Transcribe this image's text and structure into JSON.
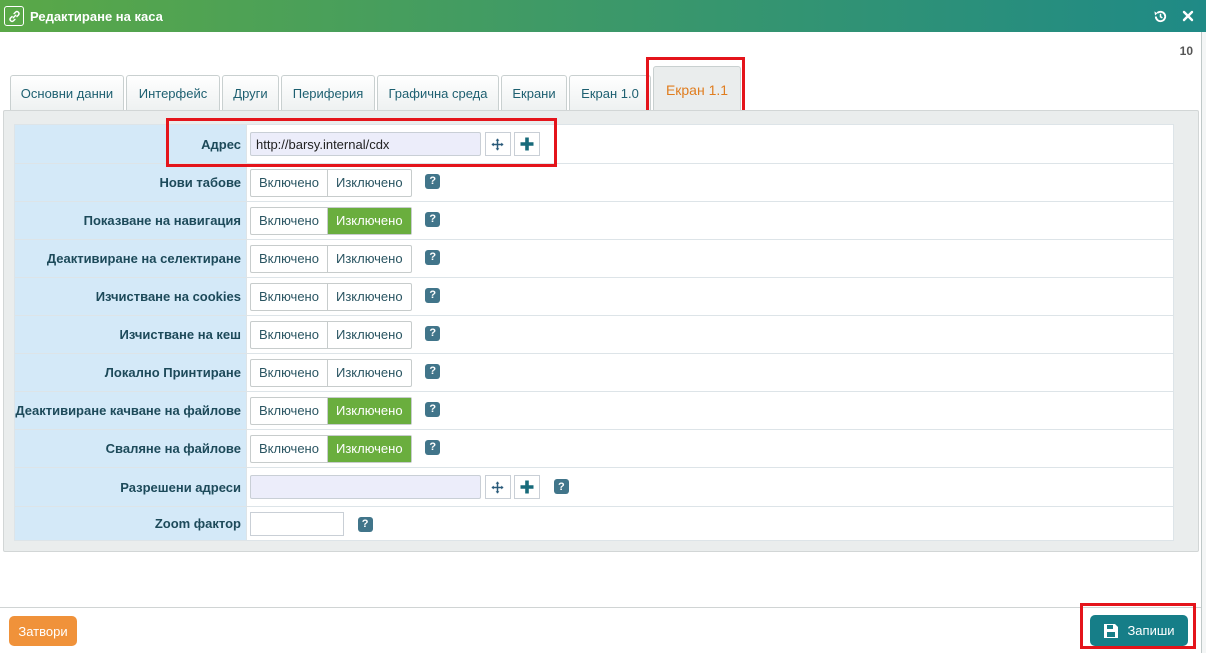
{
  "window": {
    "title": "Редактиране на каса",
    "link_icon": "link-icon",
    "history_icon": "history-icon",
    "close_icon": "close-icon",
    "record_number": "10"
  },
  "tabs": [
    {
      "label": "Основни данни"
    },
    {
      "label": "Интерфейс"
    },
    {
      "label": "Други"
    },
    {
      "label": "Периферия"
    },
    {
      "label": "Графична среда"
    },
    {
      "label": "Екрани"
    },
    {
      "label": "Екран 1.0"
    },
    {
      "label": "Екран 1.1",
      "active": true
    }
  ],
  "form": {
    "address": {
      "label": "Адрес",
      "value": "http://barsy.internal/cdx"
    },
    "toggle_on": "Включено",
    "toggle_off": "Изключено",
    "help_glyph": "?",
    "rows": [
      {
        "label": "Нови табове",
        "selected": "none"
      },
      {
        "label": "Показване на навигация",
        "selected": "off"
      },
      {
        "label": "Деактивиране на селектиране",
        "selected": "none"
      },
      {
        "label": "Изчистване на cookies",
        "selected": "none"
      },
      {
        "label": "Изчистване на кеш",
        "selected": "none"
      },
      {
        "label": "Локално Принтиране",
        "selected": "none"
      },
      {
        "label": "Деактивиране качване на файлове",
        "selected": "off"
      },
      {
        "label": "Сваляне на файлове",
        "selected": "off"
      }
    ],
    "allowed_addresses": {
      "label": "Разрешени адреси",
      "value": ""
    },
    "zoom": {
      "label": "Zoom фактор",
      "value": ""
    }
  },
  "footer": {
    "close_label": "Затвори",
    "save_label": "Запиши",
    "save_icon": "floppy-disk-icon"
  },
  "colors": {
    "accent_green": "#6aae3e",
    "save_teal": "#167e88",
    "close_orange": "#f0923a",
    "active_tab_text": "#e07d1f",
    "highlight_red": "#e4141b"
  }
}
